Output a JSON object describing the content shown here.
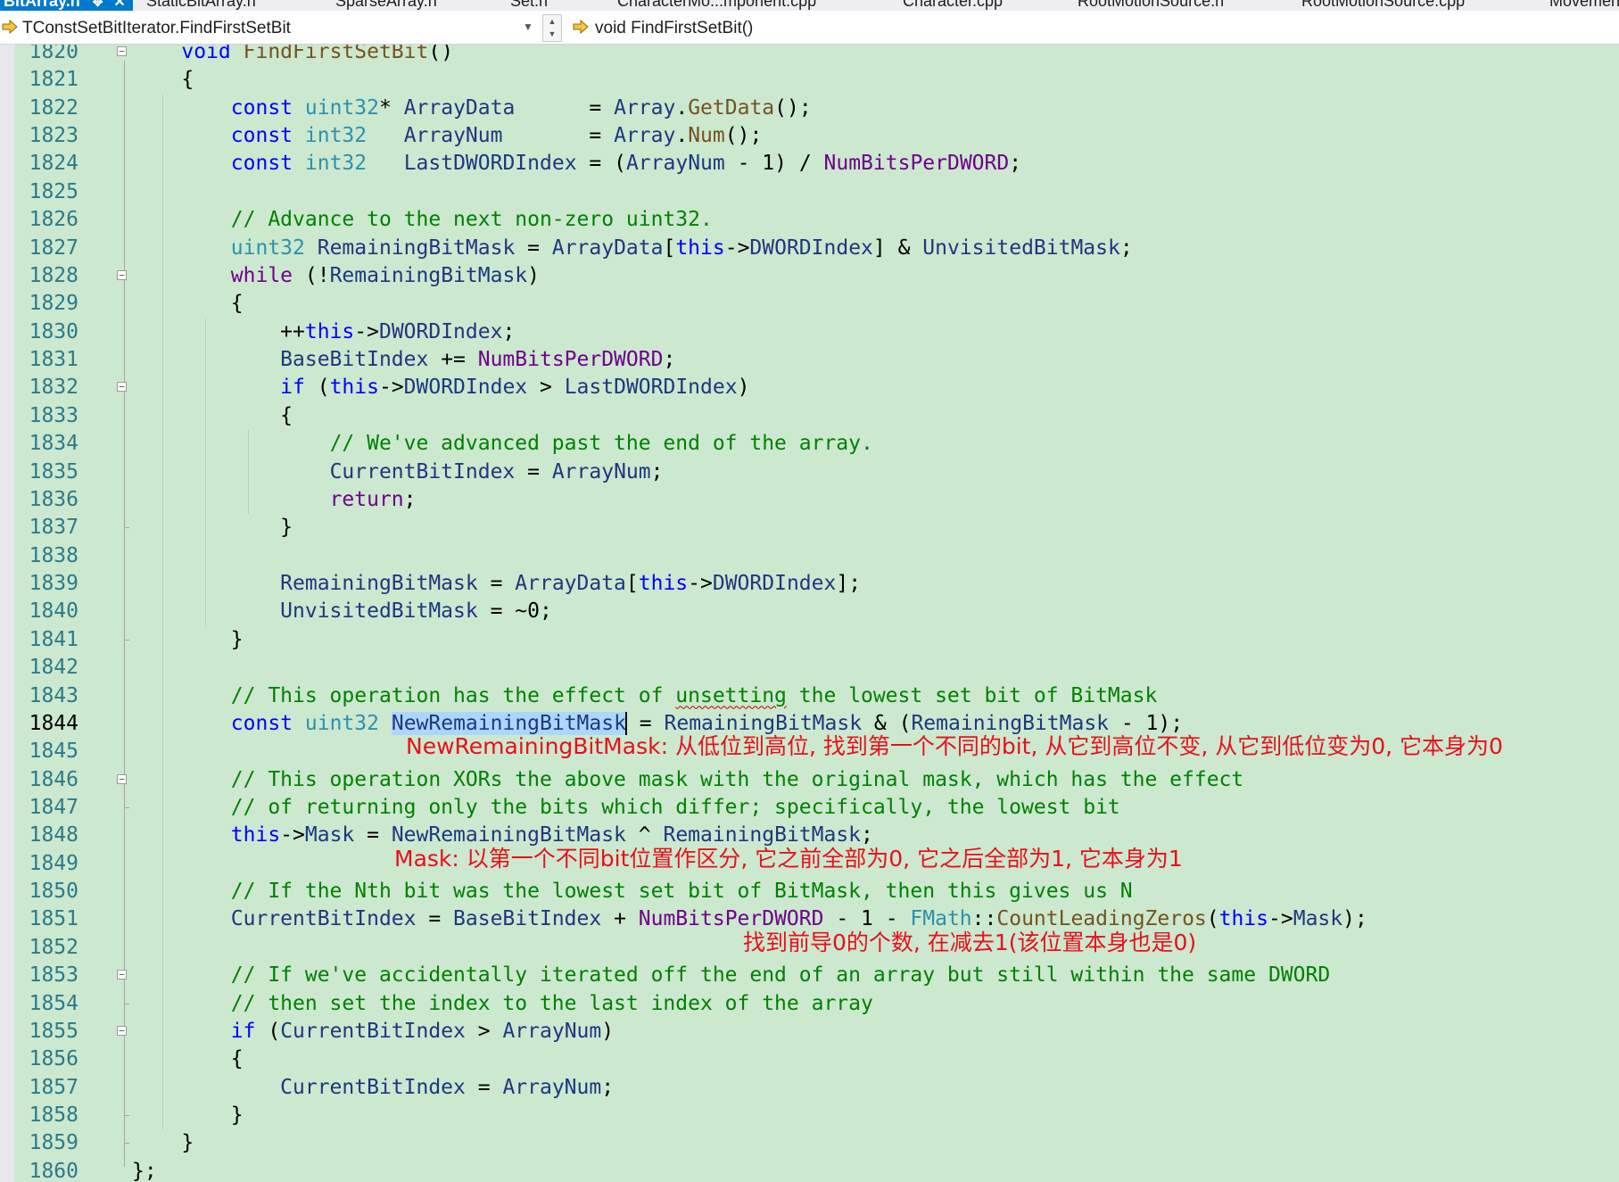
{
  "tabs": [
    {
      "label": "BitArray.h",
      "active": true
    },
    {
      "label": "StaticBitArray.h",
      "active": false
    },
    {
      "label": "SparseArray.h",
      "active": false
    },
    {
      "label": "Set.h",
      "active": false
    },
    {
      "label": "CharacterMo...mponent.cpp",
      "active": false
    },
    {
      "label": "Character.cpp",
      "active": false
    },
    {
      "label": "RootMotionSource.h",
      "active": false
    },
    {
      "label": "RootMotionSource.cpp",
      "active": false
    },
    {
      "label": "MovementC",
      "active": false
    }
  ],
  "navbar": {
    "scope": "TConstSetBitIterator.FindFirstSetBit",
    "member": "void FindFirstSetBit()"
  },
  "editor": {
    "current_line": 1844,
    "lines": [
      {
        "n": 1820,
        "tokens": [
          [
            "    ",
            ""
          ],
          [
            "void",
            "kw"
          ],
          [
            " ",
            ""
          ],
          [
            "FindFirstSetBit",
            "fn"
          ],
          [
            "()",
            ""
          ]
        ]
      },
      {
        "n": 1821,
        "tokens": [
          [
            "    {",
            ""
          ]
        ]
      },
      {
        "n": 1822,
        "tokens": [
          [
            "        ",
            ""
          ],
          [
            "const",
            "kw"
          ],
          [
            " ",
            ""
          ],
          [
            "uint32",
            "ty"
          ],
          [
            "* ",
            ""
          ],
          [
            "ArrayData",
            "var"
          ],
          [
            "      = ",
            ""
          ],
          [
            "Array",
            "var"
          ],
          [
            ".",
            ""
          ],
          [
            "GetData",
            "fn"
          ],
          [
            "();",
            ""
          ]
        ]
      },
      {
        "n": 1823,
        "tokens": [
          [
            "        ",
            ""
          ],
          [
            "const",
            "kw"
          ],
          [
            " ",
            ""
          ],
          [
            "int32",
            "ty"
          ],
          [
            "   ",
            ""
          ],
          [
            "ArrayNum",
            "var"
          ],
          [
            "       = ",
            ""
          ],
          [
            "Array",
            "var"
          ],
          [
            ".",
            ""
          ],
          [
            "Num",
            "fn"
          ],
          [
            "();",
            ""
          ]
        ]
      },
      {
        "n": 1824,
        "tokens": [
          [
            "        ",
            ""
          ],
          [
            "const",
            "kw"
          ],
          [
            " ",
            ""
          ],
          [
            "int32",
            "ty"
          ],
          [
            "   ",
            ""
          ],
          [
            "LastDWORDIndex",
            "var"
          ],
          [
            " = (",
            ""
          ],
          [
            "ArrayNum",
            "var"
          ],
          [
            " - 1) / ",
            ""
          ],
          [
            "NumBitsPerDWORD",
            "mac"
          ],
          [
            ";",
            ""
          ]
        ]
      },
      {
        "n": 1825,
        "tokens": []
      },
      {
        "n": 1826,
        "tokens": [
          [
            "        ",
            ""
          ],
          [
            "// Advance to the next non-zero uint32.",
            "cm"
          ]
        ]
      },
      {
        "n": 1827,
        "tokens": [
          [
            "        ",
            ""
          ],
          [
            "uint32",
            "ty"
          ],
          [
            " ",
            ""
          ],
          [
            "RemainingBitMask",
            "var"
          ],
          [
            " = ",
            ""
          ],
          [
            "ArrayData",
            "var"
          ],
          [
            "[",
            ""
          ],
          [
            "this",
            "kw"
          ],
          [
            "->",
            ""
          ],
          [
            "DWORDIndex",
            "var"
          ],
          [
            "] & ",
            ""
          ],
          [
            "UnvisitedBitMask",
            "var"
          ],
          [
            ";",
            ""
          ]
        ]
      },
      {
        "n": 1828,
        "tokens": [
          [
            "        ",
            ""
          ],
          [
            "while",
            "mac"
          ],
          [
            " (!",
            ""
          ],
          [
            "RemainingBitMask",
            "var"
          ],
          [
            ")",
            ""
          ]
        ]
      },
      {
        "n": 1829,
        "tokens": [
          [
            "        {",
            ""
          ]
        ]
      },
      {
        "n": 1830,
        "tokens": [
          [
            "            ++",
            ""
          ],
          [
            "this",
            "kw"
          ],
          [
            "->",
            ""
          ],
          [
            "DWORDIndex",
            "var"
          ],
          [
            ";",
            ""
          ]
        ]
      },
      {
        "n": 1831,
        "tokens": [
          [
            "            ",
            ""
          ],
          [
            "BaseBitIndex",
            "var"
          ],
          [
            " += ",
            ""
          ],
          [
            "NumBitsPerDWORD",
            "mac"
          ],
          [
            ";",
            ""
          ]
        ]
      },
      {
        "n": 1832,
        "tokens": [
          [
            "            ",
            ""
          ],
          [
            "if",
            "kw"
          ],
          [
            " (",
            ""
          ],
          [
            "this",
            "kw"
          ],
          [
            "->",
            ""
          ],
          [
            "DWORDIndex",
            "var"
          ],
          [
            " > ",
            ""
          ],
          [
            "LastDWORDIndex",
            "var"
          ],
          [
            ")",
            ""
          ]
        ]
      },
      {
        "n": 1833,
        "tokens": [
          [
            "            {",
            ""
          ]
        ]
      },
      {
        "n": 1834,
        "tokens": [
          [
            "                ",
            ""
          ],
          [
            "// We've advanced past the end of the array.",
            "cm"
          ]
        ]
      },
      {
        "n": 1835,
        "tokens": [
          [
            "                ",
            ""
          ],
          [
            "CurrentBitIndex",
            "var"
          ],
          [
            " = ",
            ""
          ],
          [
            "ArrayNum",
            "var"
          ],
          [
            ";",
            ""
          ]
        ]
      },
      {
        "n": 1836,
        "tokens": [
          [
            "                ",
            ""
          ],
          [
            "return",
            "mac"
          ],
          [
            ";",
            ""
          ]
        ]
      },
      {
        "n": 1837,
        "tokens": [
          [
            "            }",
            ""
          ]
        ]
      },
      {
        "n": 1838,
        "tokens": []
      },
      {
        "n": 1839,
        "tokens": [
          [
            "            ",
            ""
          ],
          [
            "RemainingBitMask",
            "var"
          ],
          [
            " = ",
            ""
          ],
          [
            "ArrayData",
            "var"
          ],
          [
            "[",
            ""
          ],
          [
            "this",
            "kw"
          ],
          [
            "->",
            ""
          ],
          [
            "DWORDIndex",
            "var"
          ],
          [
            "];",
            ""
          ]
        ]
      },
      {
        "n": 1840,
        "tokens": [
          [
            "            ",
            ""
          ],
          [
            "UnvisitedBitMask",
            "var"
          ],
          [
            " = ~0;",
            ""
          ]
        ]
      },
      {
        "n": 1841,
        "tokens": [
          [
            "        }",
            ""
          ]
        ]
      },
      {
        "n": 1842,
        "tokens": []
      },
      {
        "n": 1843,
        "tokens": [
          [
            "        ",
            ""
          ],
          [
            "// This operation has the effect of ",
            "cm"
          ],
          [
            "unsetting",
            "cm squig"
          ],
          [
            " the lowest set bit of BitMask",
            "cm"
          ]
        ]
      },
      {
        "n": 1844,
        "tokens": [
          [
            "        ",
            ""
          ],
          [
            "const",
            "kw"
          ],
          [
            " ",
            ""
          ],
          [
            "uint32",
            "ty"
          ],
          [
            " ",
            ""
          ],
          [
            "NewRemainingBitMask",
            "var sel"
          ],
          [
            "|caret",
            ""
          ],
          [
            " = ",
            ""
          ],
          [
            "RemainingBitMask",
            "var"
          ],
          [
            " & (",
            ""
          ],
          [
            "RemainingBitMask",
            "var"
          ],
          [
            " - 1);",
            ""
          ]
        ]
      },
      {
        "n": 1845,
        "tokens": []
      },
      {
        "n": 1846,
        "tokens": [
          [
            "        ",
            ""
          ],
          [
            "// This operation XORs the above mask with the original mask, which has the effect",
            "cm"
          ]
        ]
      },
      {
        "n": 1847,
        "tokens": [
          [
            "        ",
            ""
          ],
          [
            "// of returning only the bits which differ; specifically, the lowest bit",
            "cm"
          ]
        ]
      },
      {
        "n": 1848,
        "tokens": [
          [
            "        ",
            ""
          ],
          [
            "this",
            "kw"
          ],
          [
            "->",
            ""
          ],
          [
            "Mask",
            "var"
          ],
          [
            " = ",
            ""
          ],
          [
            "NewRemainingBitMask",
            "var"
          ],
          [
            " ^ ",
            ""
          ],
          [
            "RemainingBitMask",
            "var"
          ],
          [
            ";",
            ""
          ]
        ]
      },
      {
        "n": 1849,
        "tokens": []
      },
      {
        "n": 1850,
        "tokens": [
          [
            "        ",
            ""
          ],
          [
            "// If the Nth bit was the lowest set bit of BitMask, then this gives us N",
            "cm"
          ]
        ]
      },
      {
        "n": 1851,
        "tokens": [
          [
            "        ",
            ""
          ],
          [
            "CurrentBitIndex",
            "var"
          ],
          [
            " = ",
            ""
          ],
          [
            "BaseBitIndex",
            "var"
          ],
          [
            " + ",
            ""
          ],
          [
            "NumBitsPerDWORD",
            "mac"
          ],
          [
            " - 1 - ",
            ""
          ],
          [
            "FMath",
            "ty"
          ],
          [
            "::",
            ""
          ],
          [
            "CountLeadingZeros",
            "fn"
          ],
          [
            "(",
            ""
          ],
          [
            "this",
            "kw"
          ],
          [
            "->",
            ""
          ],
          [
            "Mask",
            "var"
          ],
          [
            ");",
            ""
          ]
        ]
      },
      {
        "n": 1852,
        "tokens": []
      },
      {
        "n": 1853,
        "tokens": [
          [
            "        ",
            ""
          ],
          [
            "// If we've accidentally iterated off the end of an array but still within the same DWORD",
            "cm"
          ]
        ]
      },
      {
        "n": 1854,
        "tokens": [
          [
            "        ",
            ""
          ],
          [
            "// then set the index to the last index of the array",
            "cm"
          ]
        ]
      },
      {
        "n": 1855,
        "tokens": [
          [
            "        ",
            ""
          ],
          [
            "if",
            "kw"
          ],
          [
            " (",
            ""
          ],
          [
            "CurrentBitIndex",
            "var"
          ],
          [
            " > ",
            ""
          ],
          [
            "ArrayNum",
            "var"
          ],
          [
            ")",
            ""
          ]
        ]
      },
      {
        "n": 1856,
        "tokens": [
          [
            "        {",
            ""
          ]
        ]
      },
      {
        "n": 1857,
        "tokens": [
          [
            "            ",
            ""
          ],
          [
            "CurrentBitIndex",
            "var"
          ],
          [
            " = ",
            ""
          ],
          [
            "ArrayNum",
            "var"
          ],
          [
            ";",
            ""
          ]
        ]
      },
      {
        "n": 1858,
        "tokens": [
          [
            "        }",
            ""
          ]
        ]
      },
      {
        "n": 1859,
        "tokens": [
          [
            "    }",
            ""
          ]
        ]
      },
      {
        "n": 1860,
        "tokens": [
          [
            "};",
            ""
          ]
        ]
      }
    ],
    "fold_lines": [
      1820,
      1828,
      1832,
      1846,
      1853,
      1855
    ],
    "fold_end_lines": [
      1837,
      1841,
      1847,
      1854,
      1858,
      1859
    ]
  },
  "annotations": [
    {
      "after_line": 1844,
      "text": "NewRemainingBitMask: 从低位到高位, 找到第一个不同的bit, 从它到高位不变, 从它到低位变为0, 它本身为0"
    },
    {
      "after_line": 1848,
      "text": "Mask: 以第一个不同bit位置作区分, 它之前全部为0, 它之后全部为1, 它本身为1"
    },
    {
      "after_line": 1851,
      "text": "找到前导0的个数, 在减去1(该位置本身也是0)"
    }
  ],
  "colors": {
    "editor_bg": "#cce8cf",
    "keyword": "#0000ff",
    "type": "#2b91af",
    "function": "#74531f",
    "macro": "#6f008a",
    "comment": "#008000",
    "variable": "#1f377f",
    "annotation": "#e8101a",
    "tab_active": "#007acc"
  }
}
